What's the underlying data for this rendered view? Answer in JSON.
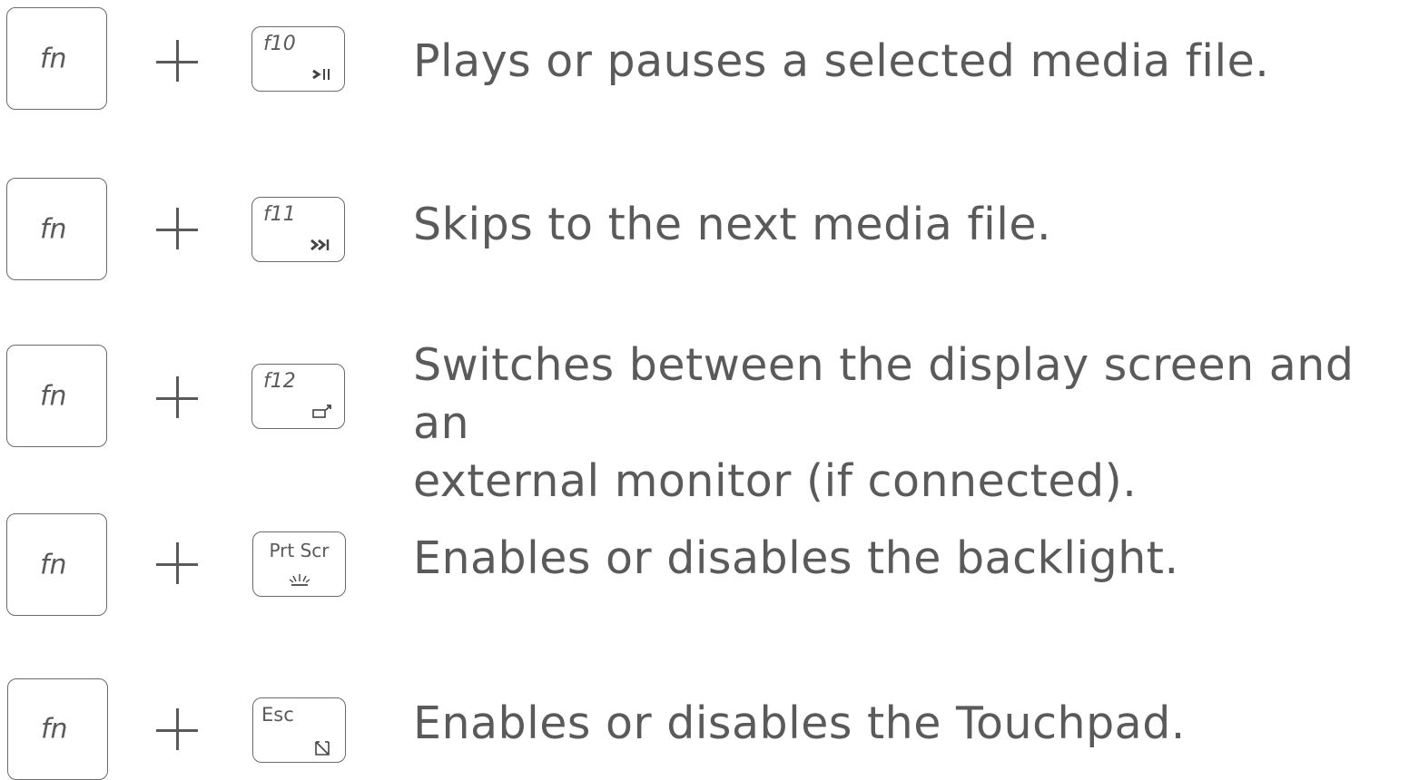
{
  "shortcuts": [
    {
      "modifier": "fn",
      "key": "f10",
      "key_icon": "play-pause-icon",
      "description": "Plays or pauses a selected media file."
    },
    {
      "modifier": "fn",
      "key": "f11",
      "key_icon": "skip-next-icon",
      "description": "Skips to the next media file."
    },
    {
      "modifier": "fn",
      "key": "f12",
      "key_icon": "external-display-icon",
      "description_line1": "Switches between the display screen and an",
      "description_line2": "external monitor (if connected)."
    },
    {
      "modifier": "fn",
      "key": "Prt Scr",
      "key_icon": "backlight-icon",
      "description": "Enables or disables the backlight."
    },
    {
      "modifier": "fn",
      "key": "Esc",
      "key_icon": "touchpad-icon",
      "description": "Enables or disables the Touchpad."
    }
  ],
  "colors": {
    "text": "#5a5a5a",
    "key_border": "#6a6a6a",
    "background": "#ffffff"
  }
}
